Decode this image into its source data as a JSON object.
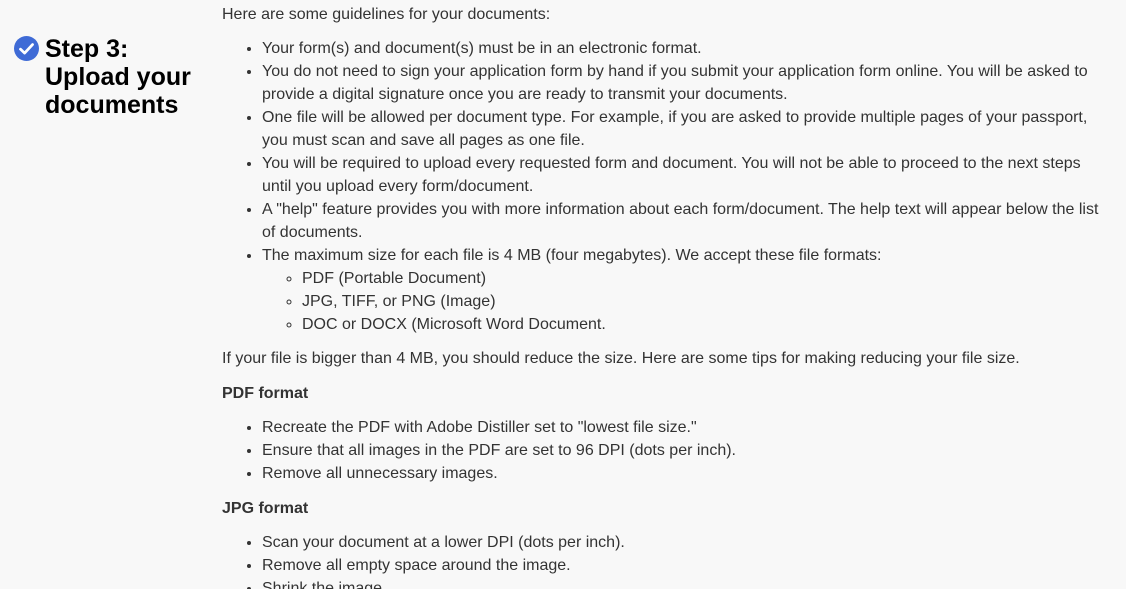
{
  "step": {
    "icon": "check-circle-icon",
    "accent_color": "#3f6bd6",
    "title": "Step 3: Upload your documents"
  },
  "intro": "Here are some guidelines for your documents:",
  "guidelines": [
    "Your form(s) and document(s) must be in an electronic format.",
    "You do not need to sign your application form by hand if you submit your application form online. You will be asked to provide a digital signature once you are ready to transmit your documents.",
    "One file will be allowed per document type. For example, if you are asked to provide multiple pages of your passport, you must scan and save all pages as one file.",
    "You will be required to upload every requested form and document. You will not be able to proceed to the next steps until you upload every form/document.",
    "A \"help\" feature provides you with more information about each form/document. The help text will appear below the list of documents.",
    "The maximum size for each file is 4 MB (four megabytes). We accept these file formats:"
  ],
  "file_formats": [
    "PDF (Portable Document)",
    "JPG, TIFF, or PNG (Image)",
    "DOC or DOCX (Microsoft Word Document."
  ],
  "size_note": "If your file is bigger than 4 MB, you should reduce the size. Here are some tips for making reducing your file size.",
  "pdf_section": {
    "heading": "PDF format",
    "tips": [
      "Recreate the PDF with Adobe Distiller set to \"lowest file size.\"",
      "Ensure that all images in the PDF are set to 96 DPI (dots per inch).",
      "Remove all unnecessary images."
    ]
  },
  "jpg_section": {
    "heading": "JPG format",
    "tips": [
      "Scan your document at a lower DPI (dots per inch).",
      "Remove all empty space around the image.",
      "Shrink the image."
    ]
  }
}
